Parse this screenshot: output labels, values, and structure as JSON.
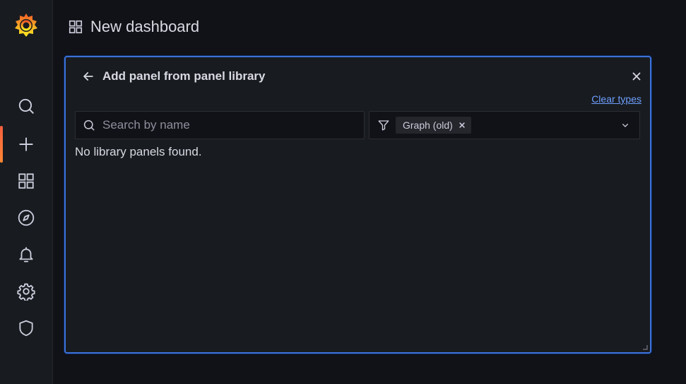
{
  "sidebar": {
    "logo": "grafana-logo",
    "items": [
      {
        "name": "search",
        "icon": "search-icon"
      },
      {
        "name": "create",
        "icon": "plus-icon",
        "active": true
      },
      {
        "name": "dashboards",
        "icon": "apps-icon"
      },
      {
        "name": "explore",
        "icon": "compass-icon"
      },
      {
        "name": "alerting",
        "icon": "bell-icon"
      },
      {
        "name": "configuration",
        "icon": "cog-icon"
      },
      {
        "name": "server-admin",
        "icon": "shield-icon"
      }
    ]
  },
  "header": {
    "icon": "apps-icon",
    "title": "New dashboard"
  },
  "panel": {
    "title": "Add panel from panel library",
    "clear_types_label": "Clear types",
    "search_placeholder": "Search by name",
    "search_value": "",
    "filter_chip_label": "Graph (old)",
    "empty_message": "No library panels found."
  },
  "colors": {
    "accent_border": "#3d71d9",
    "link": "#6e9fff",
    "active_indicator": "#ff8833"
  }
}
